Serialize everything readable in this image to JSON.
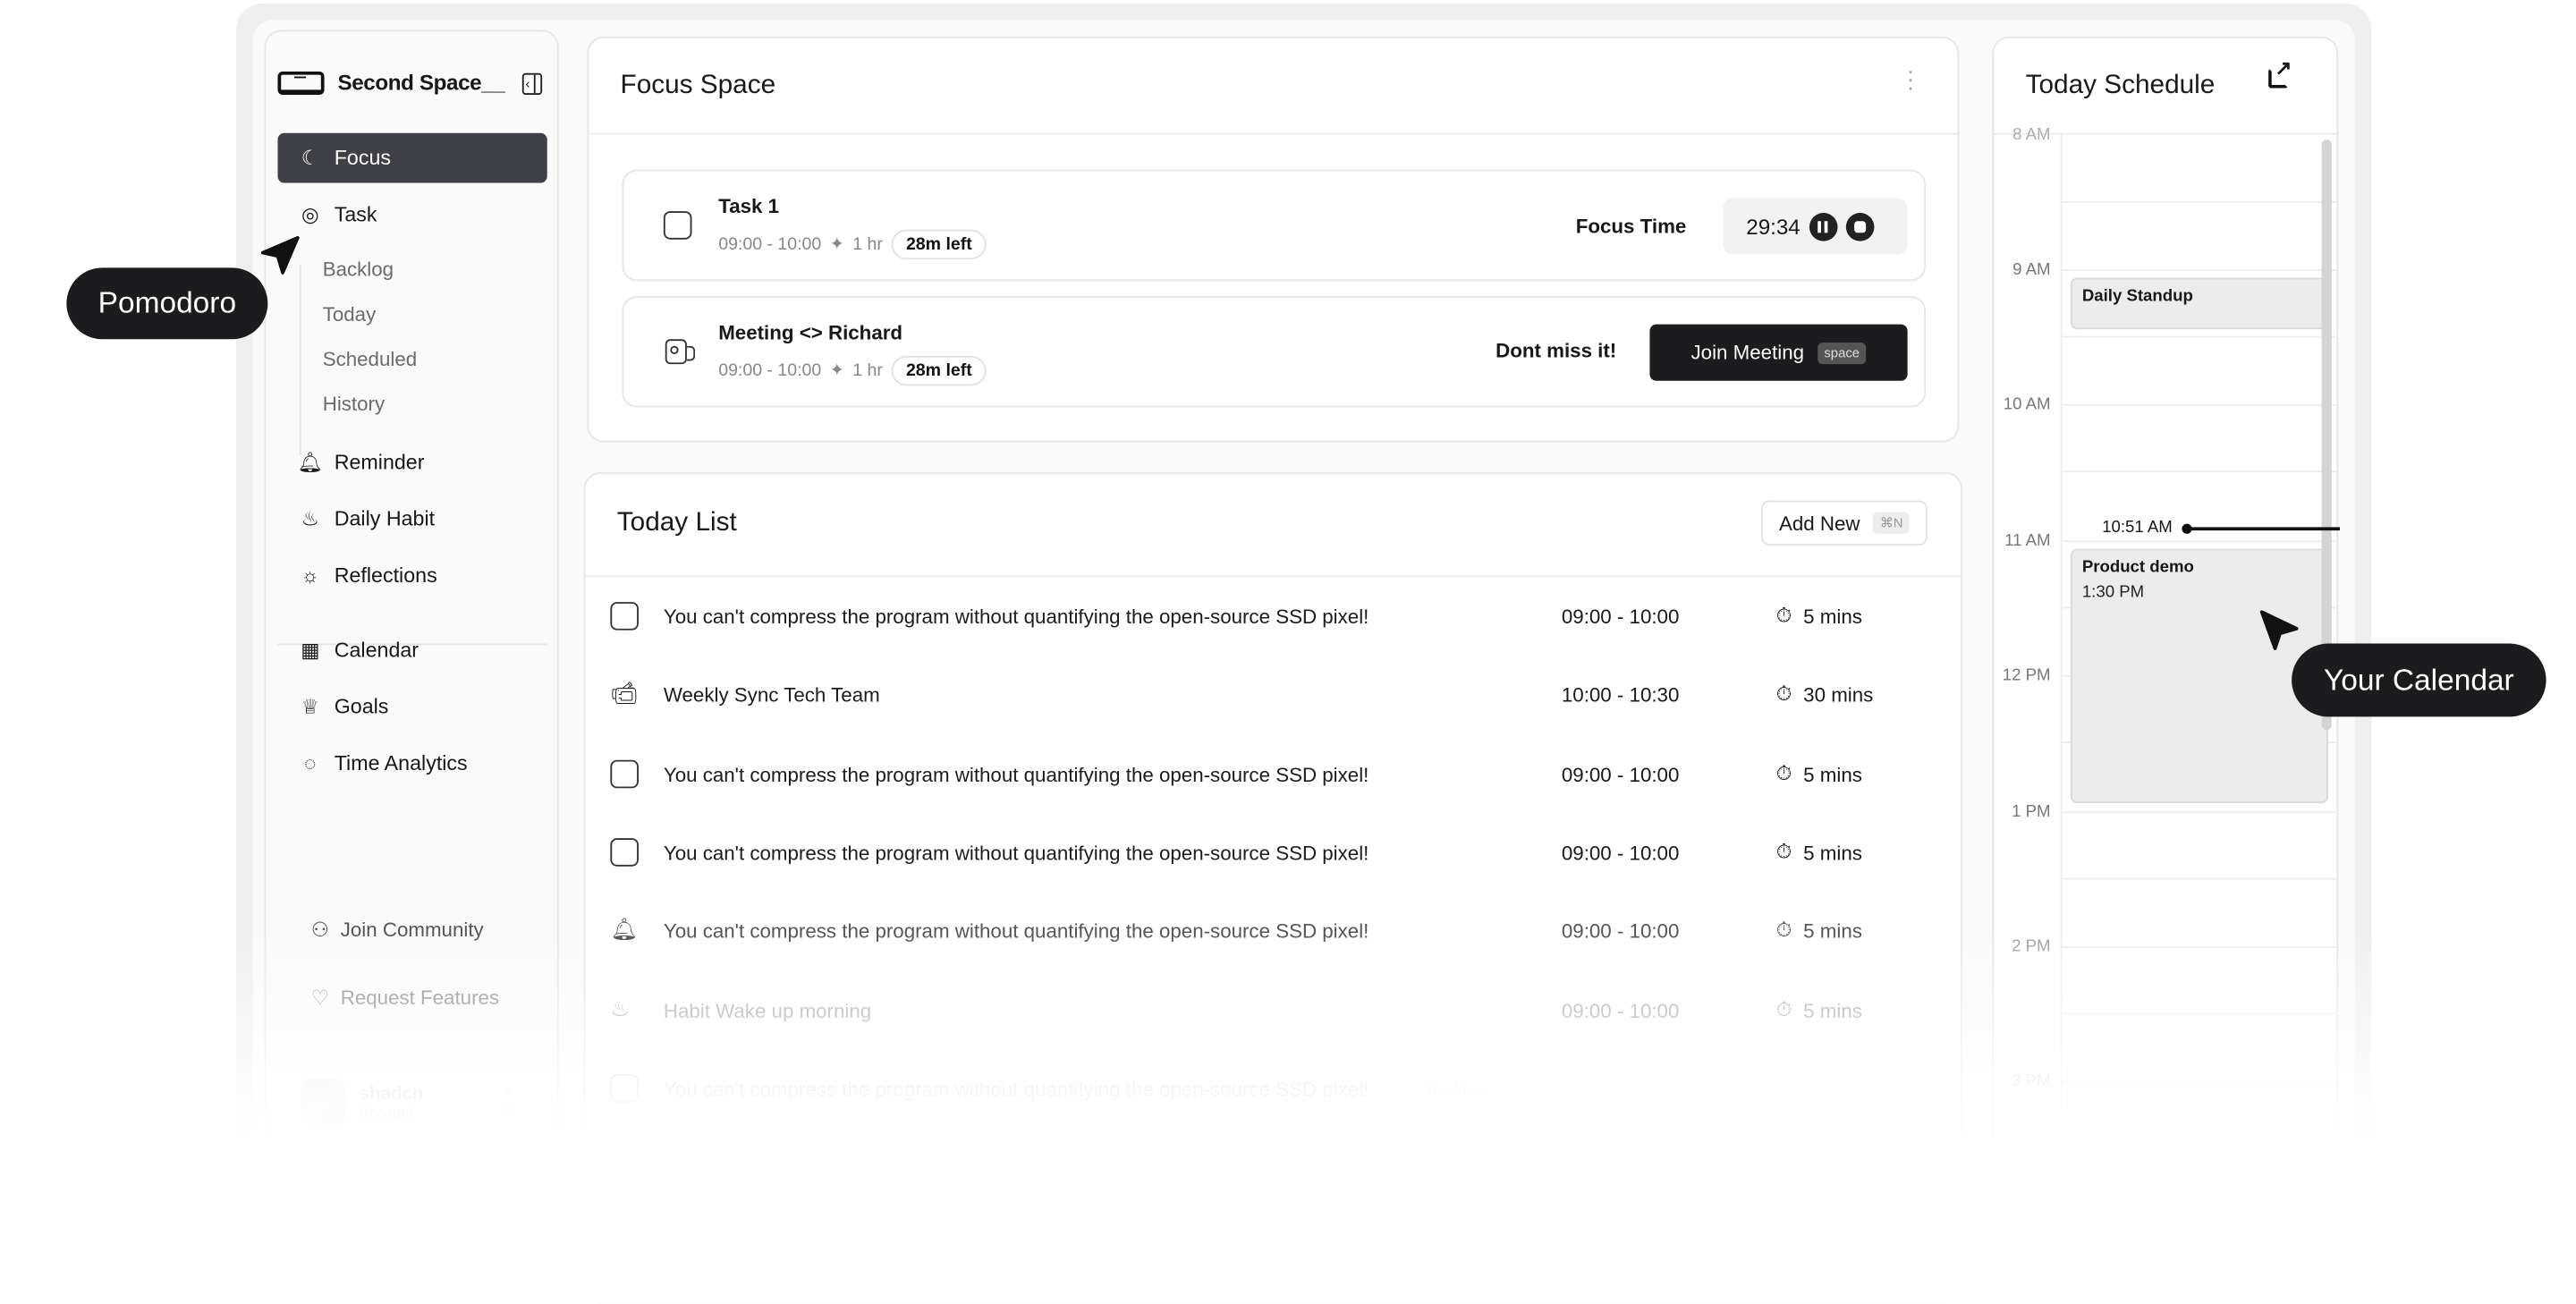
{
  "app": {
    "brand_name": "Second Space__",
    "collapse_icon": "sidebar-collapse-icon"
  },
  "sidebar": {
    "items": [
      {
        "label": "Focus",
        "icon": "moon-icon",
        "active": true
      },
      {
        "label": "Task",
        "icon": "task-icon"
      },
      {
        "label": "Reminder",
        "icon": "bell-icon"
      },
      {
        "label": "Daily Habit",
        "icon": "flame-icon"
      },
      {
        "label": "Reflections",
        "icon": "sun-icon"
      },
      {
        "label": "Calendar",
        "icon": "calendar-icon"
      },
      {
        "label": "Goals",
        "icon": "trophy-icon"
      },
      {
        "label": "Time Analytics",
        "icon": "spiral-icon"
      }
    ],
    "task_subitems": [
      "Backlog",
      "Today",
      "Scheduled",
      "History"
    ],
    "footer": [
      {
        "label": "Join Community",
        "icon": "community-icon"
      },
      {
        "label": "Request Features",
        "icon": "heart-plus-icon"
      }
    ],
    "account": {
      "name": "shadcn",
      "sub": "Account"
    }
  },
  "focus_space": {
    "title": "Focus Space",
    "cards": [
      {
        "title": "Task 1",
        "time": "09:00 - 10:00",
        "duration": "1 hr",
        "left": "28m left",
        "status_label": "Focus Time",
        "timer": "29:34"
      },
      {
        "title": "Meeting <> Richard",
        "time": "09:00 - 10:00",
        "duration": "1 hr",
        "left": "28m left",
        "status_label": "Dont miss it!",
        "button": "Join Meeting",
        "shortcut": "space"
      }
    ]
  },
  "today_list": {
    "title": "Today List",
    "add_label": "Add New",
    "add_shortcut": "⌘N",
    "rows": [
      {
        "icon": "checkbox",
        "title": "You can't compress the program without quantifying the open-source SSD pixel!",
        "time": "09:00 - 10:00",
        "duration": "5 mins"
      },
      {
        "icon": "video",
        "title": "Weekly Sync Tech Team",
        "time": "10:00 - 10:30",
        "duration": "30 mins"
      },
      {
        "icon": "checkbox",
        "title": "You can't compress the program without quantifying the open-source SSD pixel!",
        "time": "09:00 - 10:00",
        "duration": "5 mins"
      },
      {
        "icon": "checkbox",
        "title": "You can't compress the program without quantifying the open-source SSD pixel!",
        "time": "09:00 - 10:00",
        "duration": "5 mins"
      },
      {
        "icon": "bell",
        "title": "You can't compress the program without quantifying the open-source SSD pixel!",
        "time": "09:00 - 10:00",
        "duration": "5 mins"
      },
      {
        "icon": "flame",
        "title": "Habit Wake up morning",
        "time": "09:00 - 10:00",
        "duration": "5 mins"
      },
      {
        "icon": "checkbox",
        "title": "You can't compress the program without quantifying the open-source SSD pixel!",
        "badge": "Backlog"
      }
    ]
  },
  "schedule": {
    "title": "Today Schedule",
    "hours": [
      "8 AM",
      "9 AM",
      "10 AM",
      "11 AM",
      "12 PM",
      "1 PM",
      "2 PM",
      "3 PM"
    ],
    "now": "10:51 AM",
    "events": [
      {
        "title": "Daily Standup"
      },
      {
        "title": "Product demo",
        "sub": "1:30 PM"
      }
    ]
  },
  "callouts": {
    "left": "Pomodoro",
    "right": "Your Calendar"
  }
}
